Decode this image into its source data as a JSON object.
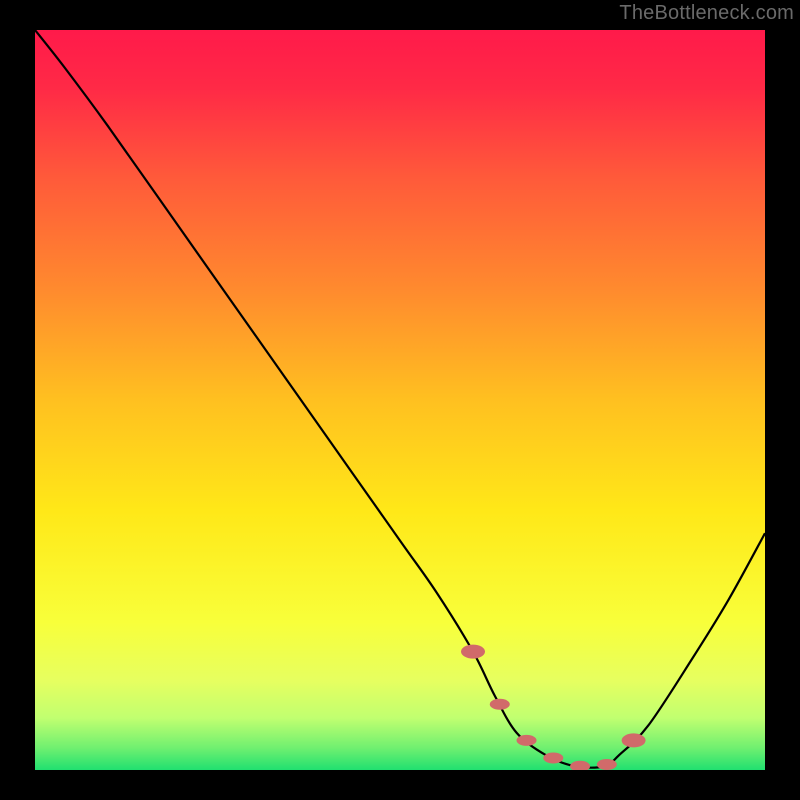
{
  "watermark": "TheBottleneck.com",
  "chart_data": {
    "type": "line",
    "title": "",
    "xlabel": "",
    "ylabel": "",
    "xlim": [
      0,
      100
    ],
    "ylim": [
      0,
      100
    ],
    "x": [
      0,
      4,
      10,
      20,
      30,
      40,
      50,
      55,
      60,
      63,
      66,
      70,
      74,
      78,
      80,
      84,
      90,
      95,
      100
    ],
    "values": [
      100,
      95,
      87,
      73,
      59,
      45,
      31,
      24,
      16,
      10,
      5,
      2,
      0.5,
      0.5,
      2,
      6,
      15,
      23,
      32
    ],
    "gradient_stops": [
      {
        "pos": 0.0,
        "color": "#ff1a4a"
      },
      {
        "pos": 0.08,
        "color": "#ff2a46"
      },
      {
        "pos": 0.2,
        "color": "#ff5a3a"
      },
      {
        "pos": 0.35,
        "color": "#ff8a2e"
      },
      {
        "pos": 0.5,
        "color": "#ffc020"
      },
      {
        "pos": 0.65,
        "color": "#ffe818"
      },
      {
        "pos": 0.8,
        "color": "#f8ff3a"
      },
      {
        "pos": 0.88,
        "color": "#e6ff60"
      },
      {
        "pos": 0.93,
        "color": "#c0ff70"
      },
      {
        "pos": 0.97,
        "color": "#70f070"
      },
      {
        "pos": 1.0,
        "color": "#20e070"
      }
    ],
    "marker_band": {
      "x_start": 60,
      "x_end": 82,
      "color": "#d16a6a"
    },
    "curve_color": "#000000"
  }
}
